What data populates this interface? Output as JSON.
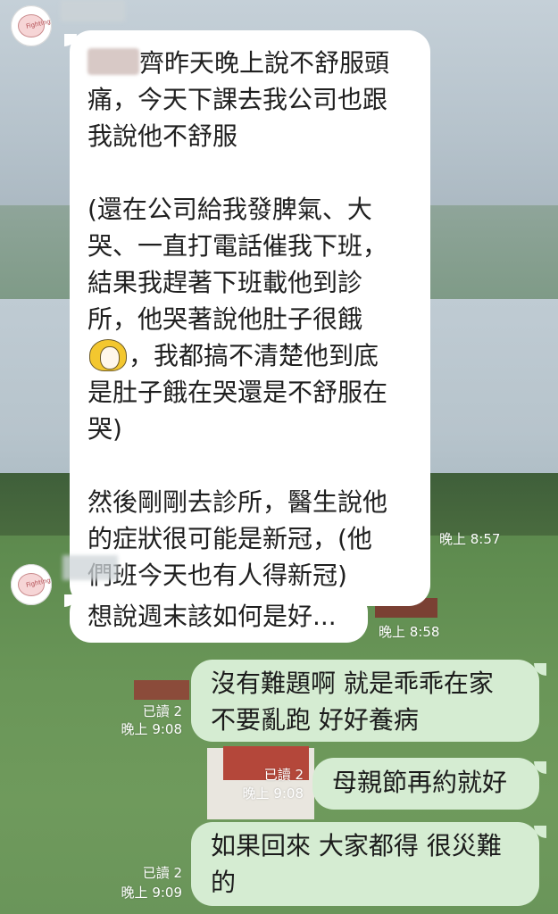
{
  "messages": {
    "m1": {
      "text_part1": "齊昨天晚上說不舒服頭\n痛，今天下課去我公司也跟\n我說他不舒服\n\n(還在公司給我發脾氣、大\n哭、一直打電話催我下班，\n結果我趕著下班載他到診\n所，他哭著說他肚子很餓\n",
      "text_part2": "，我都搞不清楚他到底\n是肚子餓在哭還是不舒服在\n哭)\n\n然後剛剛去診所，醫生說他\n的症狀很可能是新冠，(他\n們班今天也有人得新冠)",
      "time": "晚上 8:57"
    },
    "m2": {
      "text": "想說週末該如何是好...",
      "time": "晚上 8:58"
    },
    "m3": {
      "text": "沒有難題啊 就是乖乖在家\n不要亂跑 好好養病",
      "read": "已讀 2",
      "time": "晚上 9:08"
    },
    "m4": {
      "text": "母親節再約就好",
      "read": "已讀 2",
      "time": "晚上 9:08"
    },
    "m5": {
      "text": "如果回來 大家都得 很災難\n的",
      "read": "已讀 2",
      "time": "晚上 9:09"
    }
  },
  "avatar_label": "Fighting",
  "icons": [
    "avatar-icon",
    "sticker-emoji-icon"
  ],
  "colors": {
    "incoming_bubble": "#ffffff",
    "outgoing_bubble": "#d5ecd2",
    "meta_text": "#ffffff"
  }
}
